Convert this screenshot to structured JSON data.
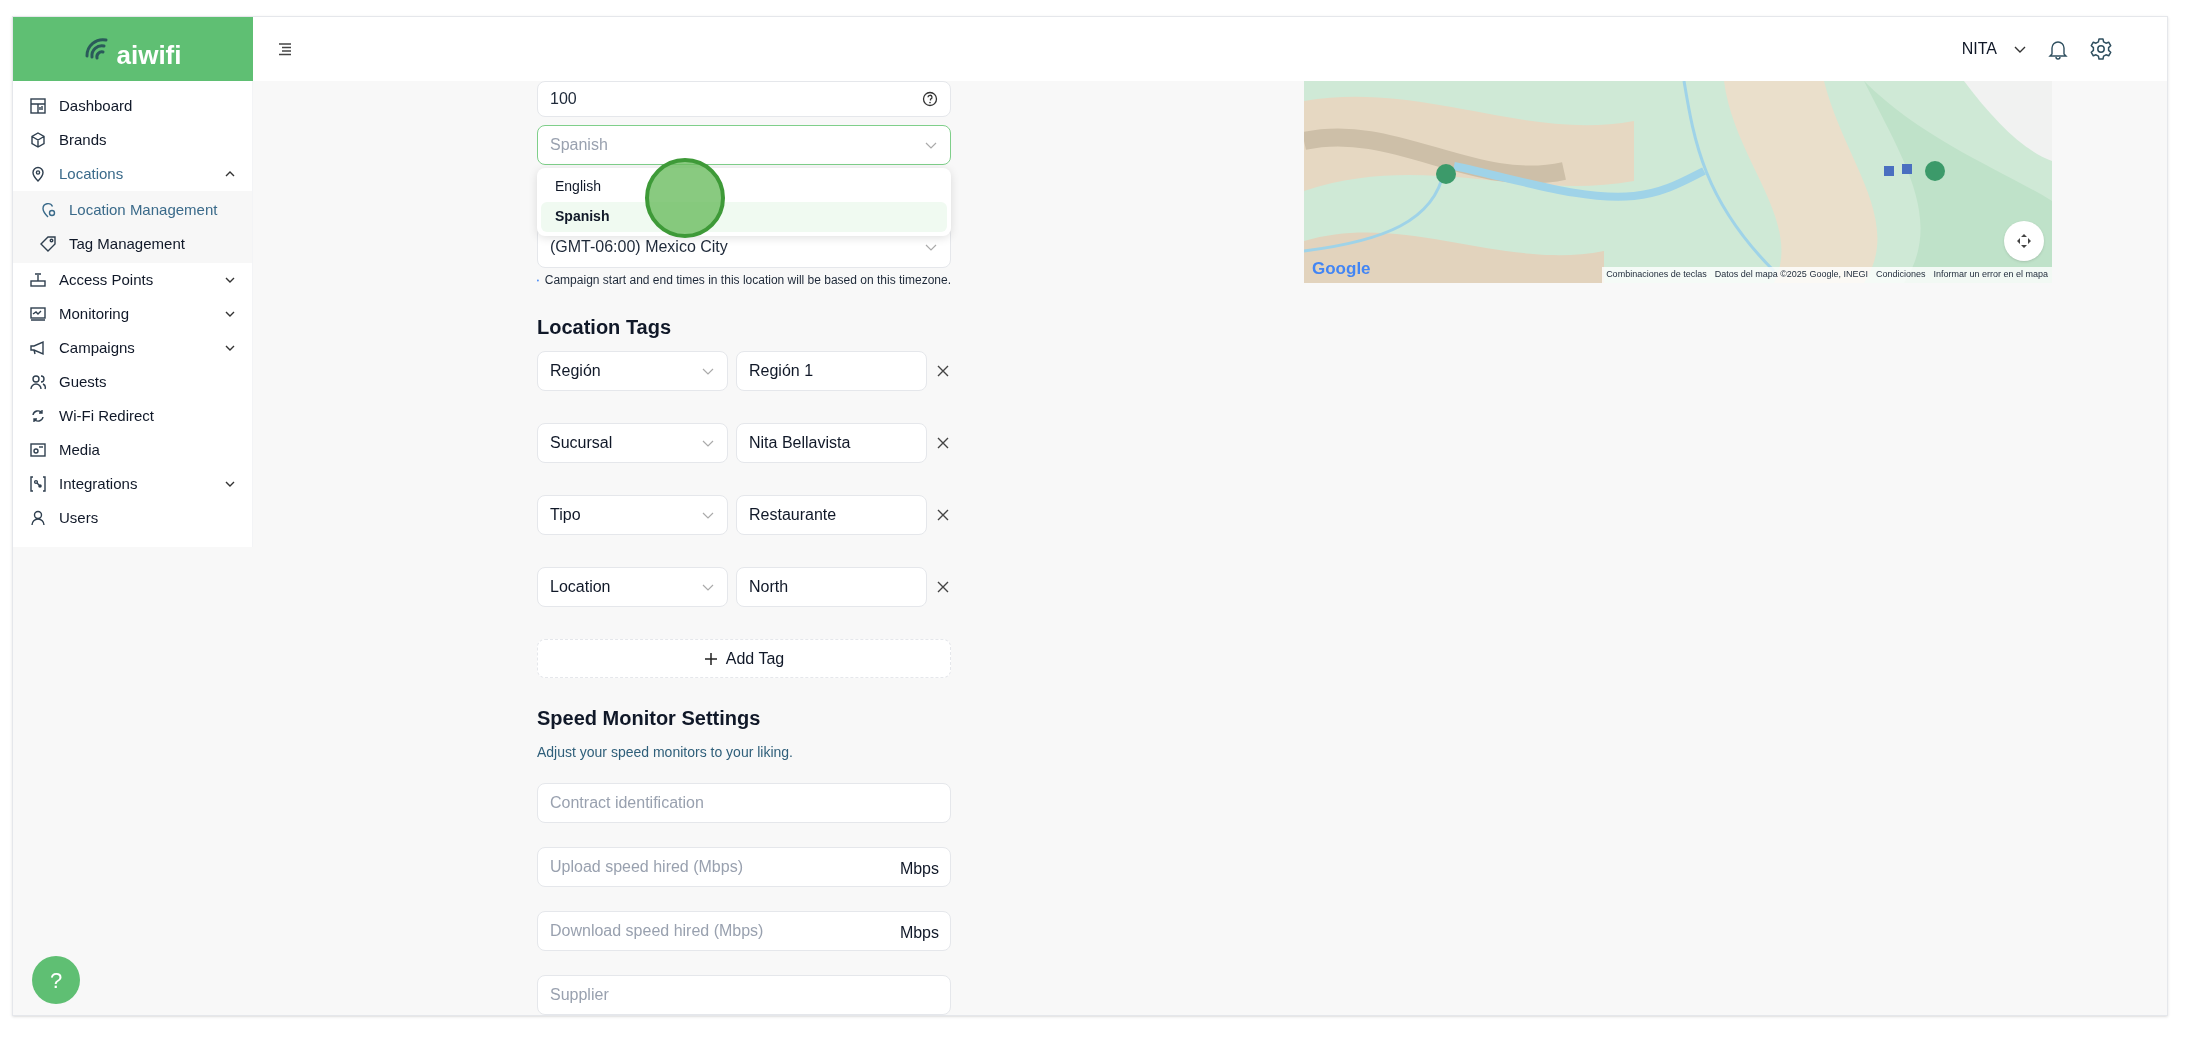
{
  "logo": "aiwifi",
  "sidebar": {
    "items": [
      {
        "label": "Dashboard",
        "selected": false
      },
      {
        "label": "Brands",
        "selected": false
      },
      {
        "label": "Locations",
        "selected": true,
        "expanded": true,
        "children": [
          {
            "label": "Location Management",
            "selected": true
          },
          {
            "label": "Tag Management",
            "selected": false
          }
        ]
      },
      {
        "label": "Access Points",
        "selected": false,
        "expanded": false
      },
      {
        "label": "Monitoring",
        "selected": false,
        "expanded": false
      },
      {
        "label": "Campaigns",
        "selected": false,
        "expanded": false
      },
      {
        "label": "Guests",
        "selected": false
      },
      {
        "label": "Wi-Fi Redirect",
        "selected": false
      },
      {
        "label": "Media",
        "selected": false
      },
      {
        "label": "Integrations",
        "selected": false,
        "expanded": false
      },
      {
        "label": "Users",
        "selected": false
      }
    ]
  },
  "header": {
    "user": "NITA"
  },
  "form": {
    "number_field": {
      "value": "100"
    },
    "language_select": {
      "value": "Spanish",
      "open": true,
      "options": [
        {
          "label": "English",
          "selected": false
        },
        {
          "label": "Spanish",
          "selected": true
        }
      ]
    },
    "timezone_select": {
      "value": "(GMT-06:00) Mexico City"
    },
    "timezone_note": "Campaign start and end times in this location will be based on this timezone.",
    "tags_heading": "Location Tags",
    "tags": [
      {
        "key": "Región",
        "value": "Región 1"
      },
      {
        "key": "Sucursal",
        "value": "Nita Bellavista"
      },
      {
        "key": "Tipo",
        "value": "Restaurante"
      },
      {
        "key": "Location",
        "value": "North"
      }
    ],
    "add_tag": "Add Tag",
    "speed_heading": "Speed Monitor Settings",
    "speed_subtitle": "Adjust your speed monitors to your liking.",
    "speed_fields": [
      {
        "placeholder": "Contract identification"
      },
      {
        "placeholder": "Upload speed hired (Mbps)",
        "unit": "Mbps"
      },
      {
        "placeholder": "Download speed hired (Mbps)",
        "unit": "Mbps"
      },
      {
        "placeholder": "Supplier"
      }
    ]
  },
  "map": {
    "kind": "picture",
    "logo": "Google",
    "attribution": [
      "Combinaciones de teclas",
      "Datos del mapa ©2025 Google, INEGI",
      "Condiciones",
      "Informar un error en el mapa"
    ]
  },
  "help_button": "?"
}
